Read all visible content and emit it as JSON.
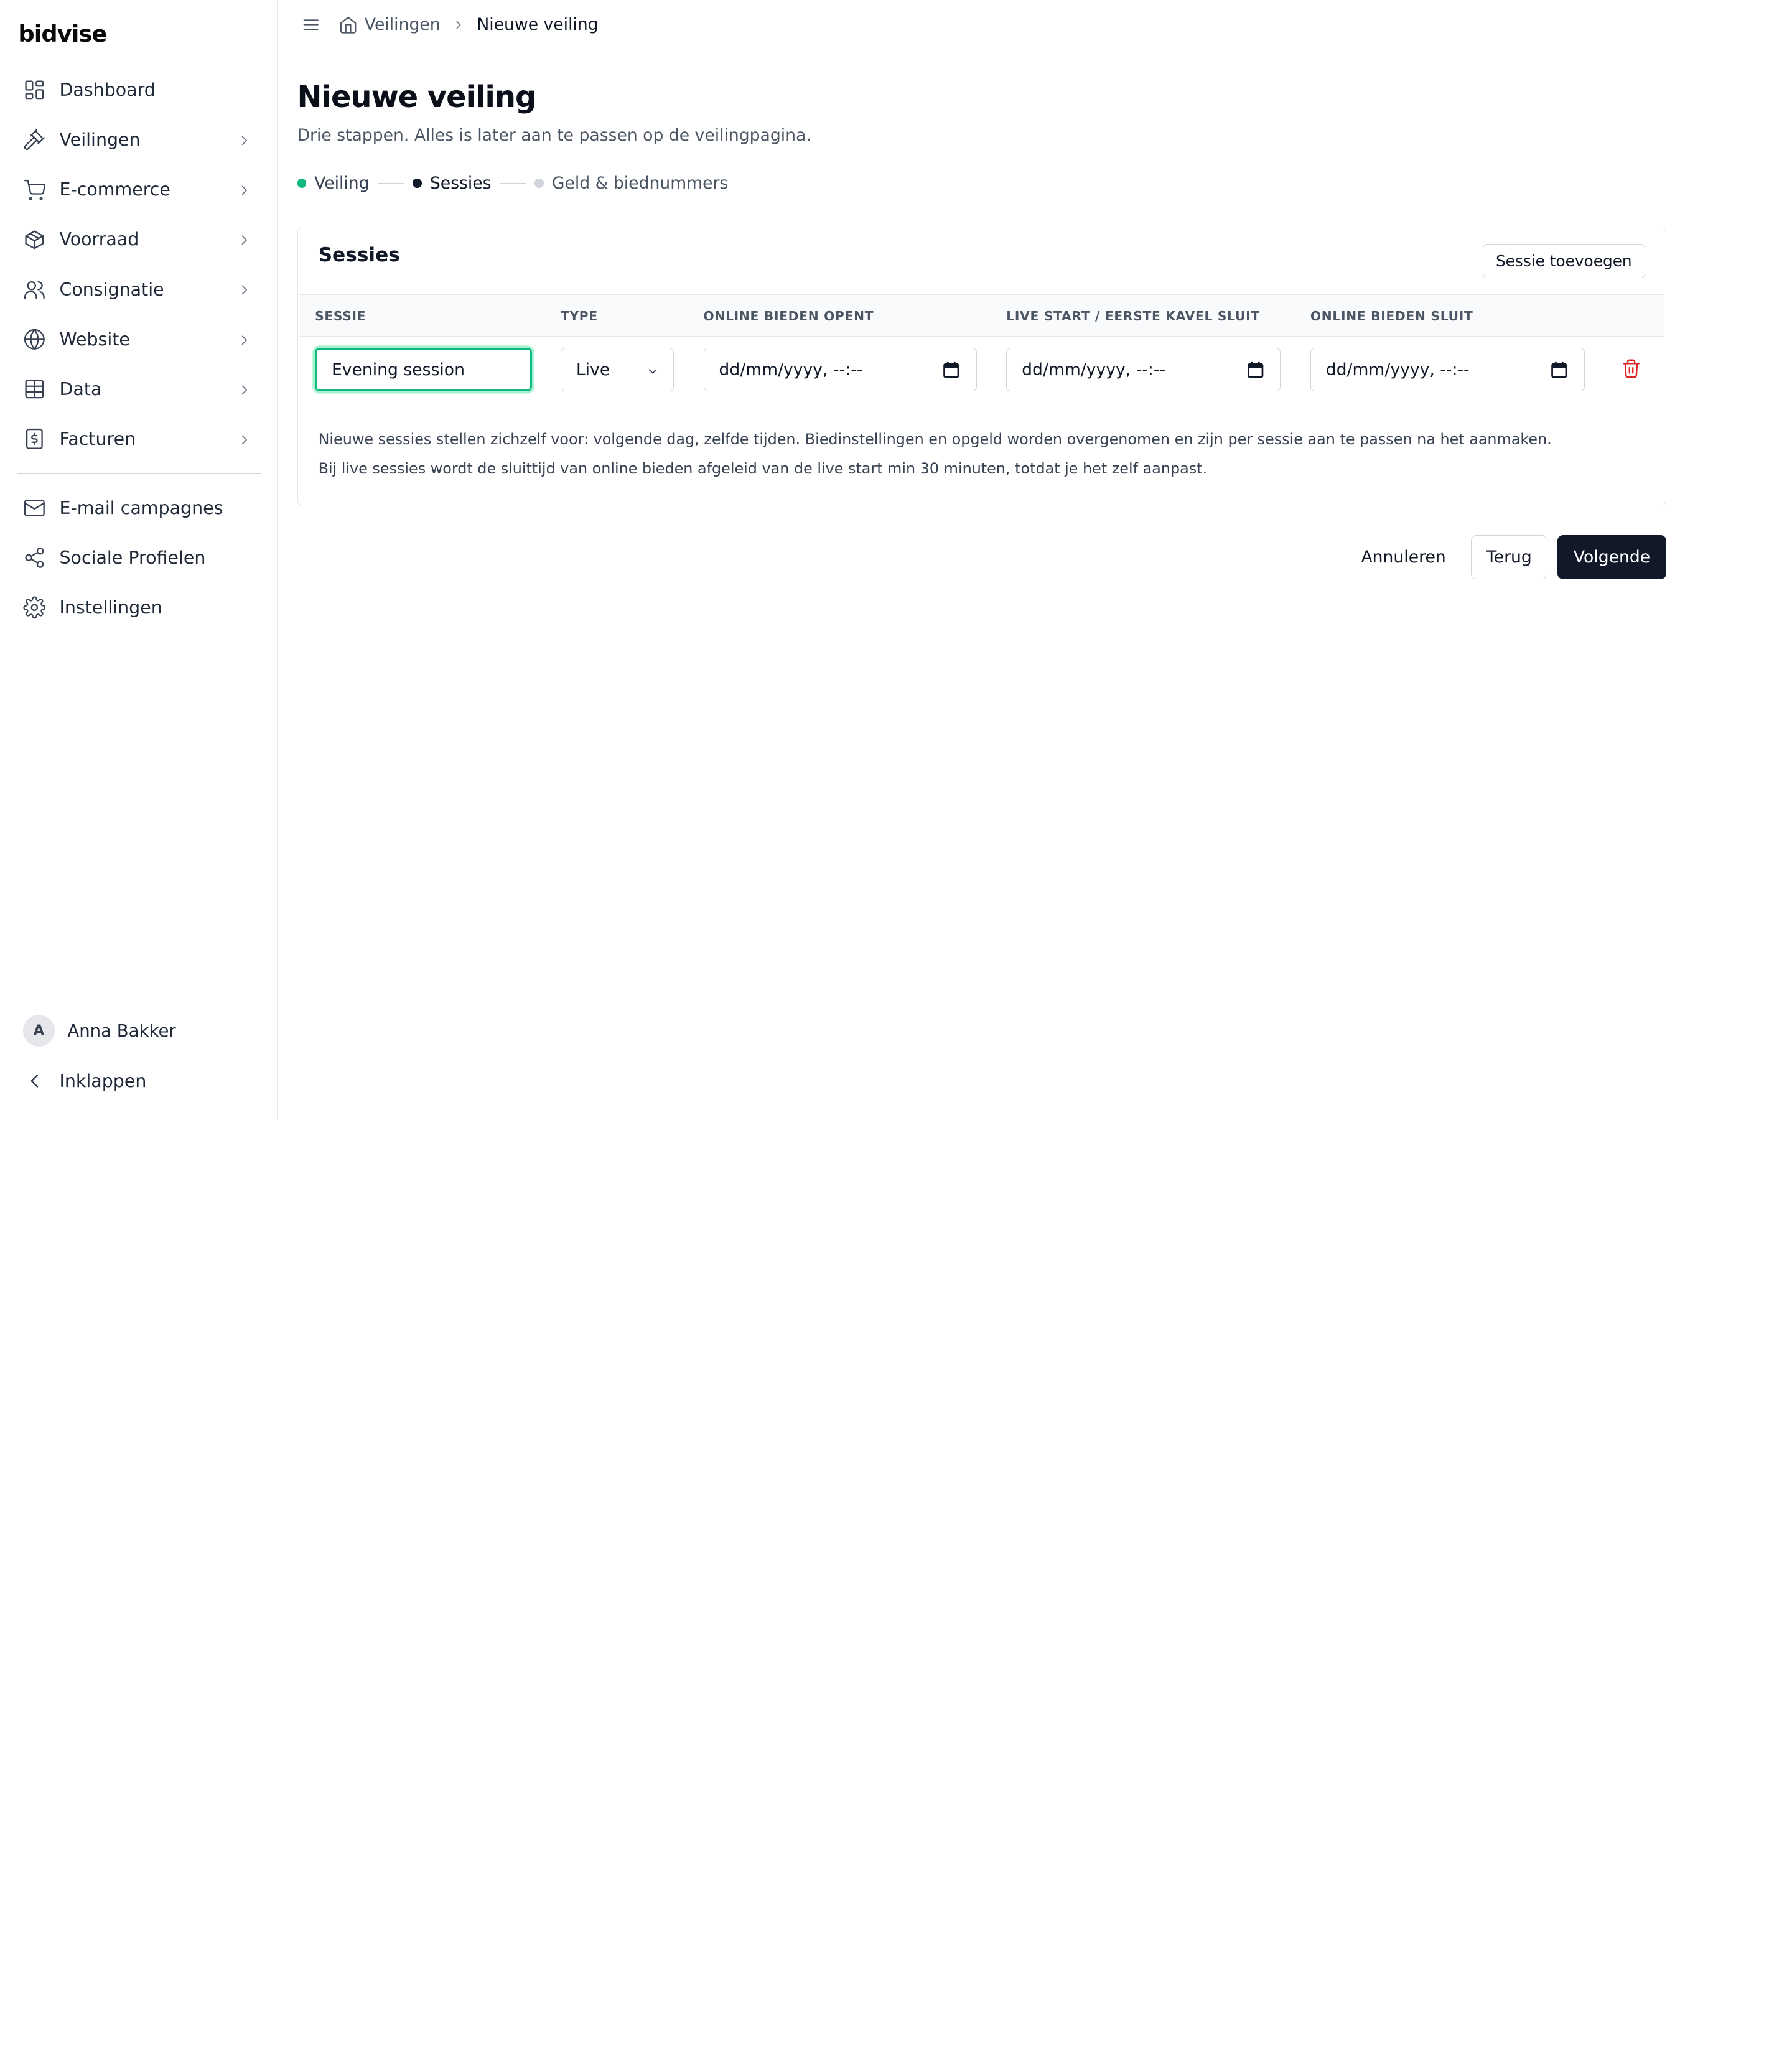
{
  "app": {
    "logo": "bidvise"
  },
  "sidebar": {
    "items": [
      {
        "label": "Dashboard",
        "icon": "dashboard-icon",
        "has_chevron": false
      },
      {
        "label": "Veilingen",
        "icon": "gavel-icon",
        "has_chevron": true
      },
      {
        "label": "E-commerce",
        "icon": "cart-icon",
        "has_chevron": true
      },
      {
        "label": "Voorraad",
        "icon": "package-icon",
        "has_chevron": true
      },
      {
        "label": "Consignatie",
        "icon": "users-icon",
        "has_chevron": true
      },
      {
        "label": "Website",
        "icon": "globe-icon",
        "has_chevron": true
      },
      {
        "label": "Data",
        "icon": "table-icon",
        "has_chevron": true
      },
      {
        "label": "Facturen",
        "icon": "invoice-icon",
        "has_chevron": true
      }
    ],
    "secondary": [
      {
        "label": "E-mail campagnes",
        "icon": "mail-icon"
      },
      {
        "label": "Sociale Profielen",
        "icon": "share-icon"
      },
      {
        "label": "Instellingen",
        "icon": "gear-icon"
      }
    ],
    "user": {
      "initial": "A",
      "name": "Anna Bakker"
    },
    "collapse_label": "Inklappen"
  },
  "breadcrumb": {
    "parent": "Veilingen",
    "current": "Nieuwe veiling"
  },
  "page": {
    "title": "Nieuwe veiling",
    "subtitle": "Drie stappen. Alles is later aan te passen op de veilingpagina."
  },
  "steps": [
    {
      "label": "Veiling",
      "state": "done",
      "color": "#10b981"
    },
    {
      "label": "Sessies",
      "state": "current",
      "color": "#111827"
    },
    {
      "label": "Geld & biednummers",
      "state": "upcoming",
      "color": "#d1d5db"
    }
  ],
  "sessions": {
    "title": "Sessies",
    "add_button": "Sessie toevoegen",
    "columns": [
      "SESSIE",
      "TYPE",
      "ONLINE BIEDEN OPENT",
      "LIVE START / EERSTE KAVEL SLUIT",
      "ONLINE BIEDEN SLUIT"
    ],
    "rows": [
      {
        "name": "Evening session",
        "type": "Live",
        "online_opens": "dd/mm/yyyy, --:--",
        "live_start": "dd/mm/yyyy, --:--",
        "online_closes": "dd/mm/yyyy, --:--"
      }
    ],
    "notes": [
      "Nieuwe sessies stellen zichzelf voor: volgende dag, zelfde tijden. Biedinstellingen en opgeld worden overgenomen en zijn per sessie aan te passen na het aanmaken.",
      "Bij live sessies wordt de sluittijd van online bieden afgeleid van de live start min 30 minuten, totdat je het zelf aanpast."
    ]
  },
  "actions": {
    "cancel": "Annuleren",
    "back": "Terug",
    "next": "Volgende"
  },
  "colors": {
    "accent": "#10b981",
    "primary": "#111827",
    "danger": "#dc2626"
  }
}
